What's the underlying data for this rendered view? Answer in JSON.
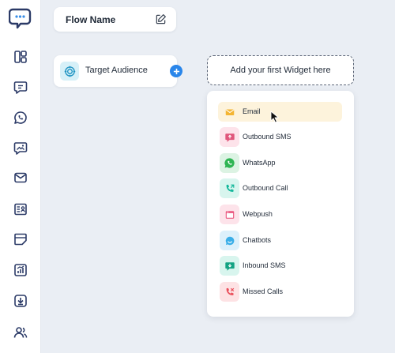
{
  "flow": {
    "name": "Flow Name"
  },
  "nodes": {
    "target_audience": "Target Audience"
  },
  "widget": {
    "add_label": "Add your first Widget here"
  },
  "menu": {
    "items": [
      {
        "label": "Email",
        "icon": "email-icon",
        "color": "#f4b533",
        "bg": "#fdf3dc"
      },
      {
        "label": "Outbound SMS",
        "icon": "outbound-sms-icon",
        "color": "#e0567b",
        "bg": "#fde3ea"
      },
      {
        "label": "WhatsApp",
        "icon": "whatsapp-icon",
        "color": "#2fb553",
        "bg": "#dcf3e3"
      },
      {
        "label": "Outbound Call",
        "icon": "outbound-call-icon",
        "color": "#12b79a",
        "bg": "#d8f5ee"
      },
      {
        "label": "Webpush",
        "icon": "webpush-icon",
        "color": "#e9577f",
        "bg": "#fde3ea"
      },
      {
        "label": "Chatbots",
        "icon": "chatbots-icon",
        "color": "#3aaee8",
        "bg": "#dcf0fb"
      },
      {
        "label": "Inbound SMS",
        "icon": "inbound-sms-icon",
        "color": "#12a383",
        "bg": "#d8f5ee"
      },
      {
        "label": "Missed Calls",
        "icon": "missed-calls-icon",
        "color": "#ea4f5b",
        "bg": "#fde2e4"
      }
    ],
    "active_index": 0
  },
  "colors": {
    "accent": "#2a86ea",
    "brand": "#2b3a67"
  }
}
